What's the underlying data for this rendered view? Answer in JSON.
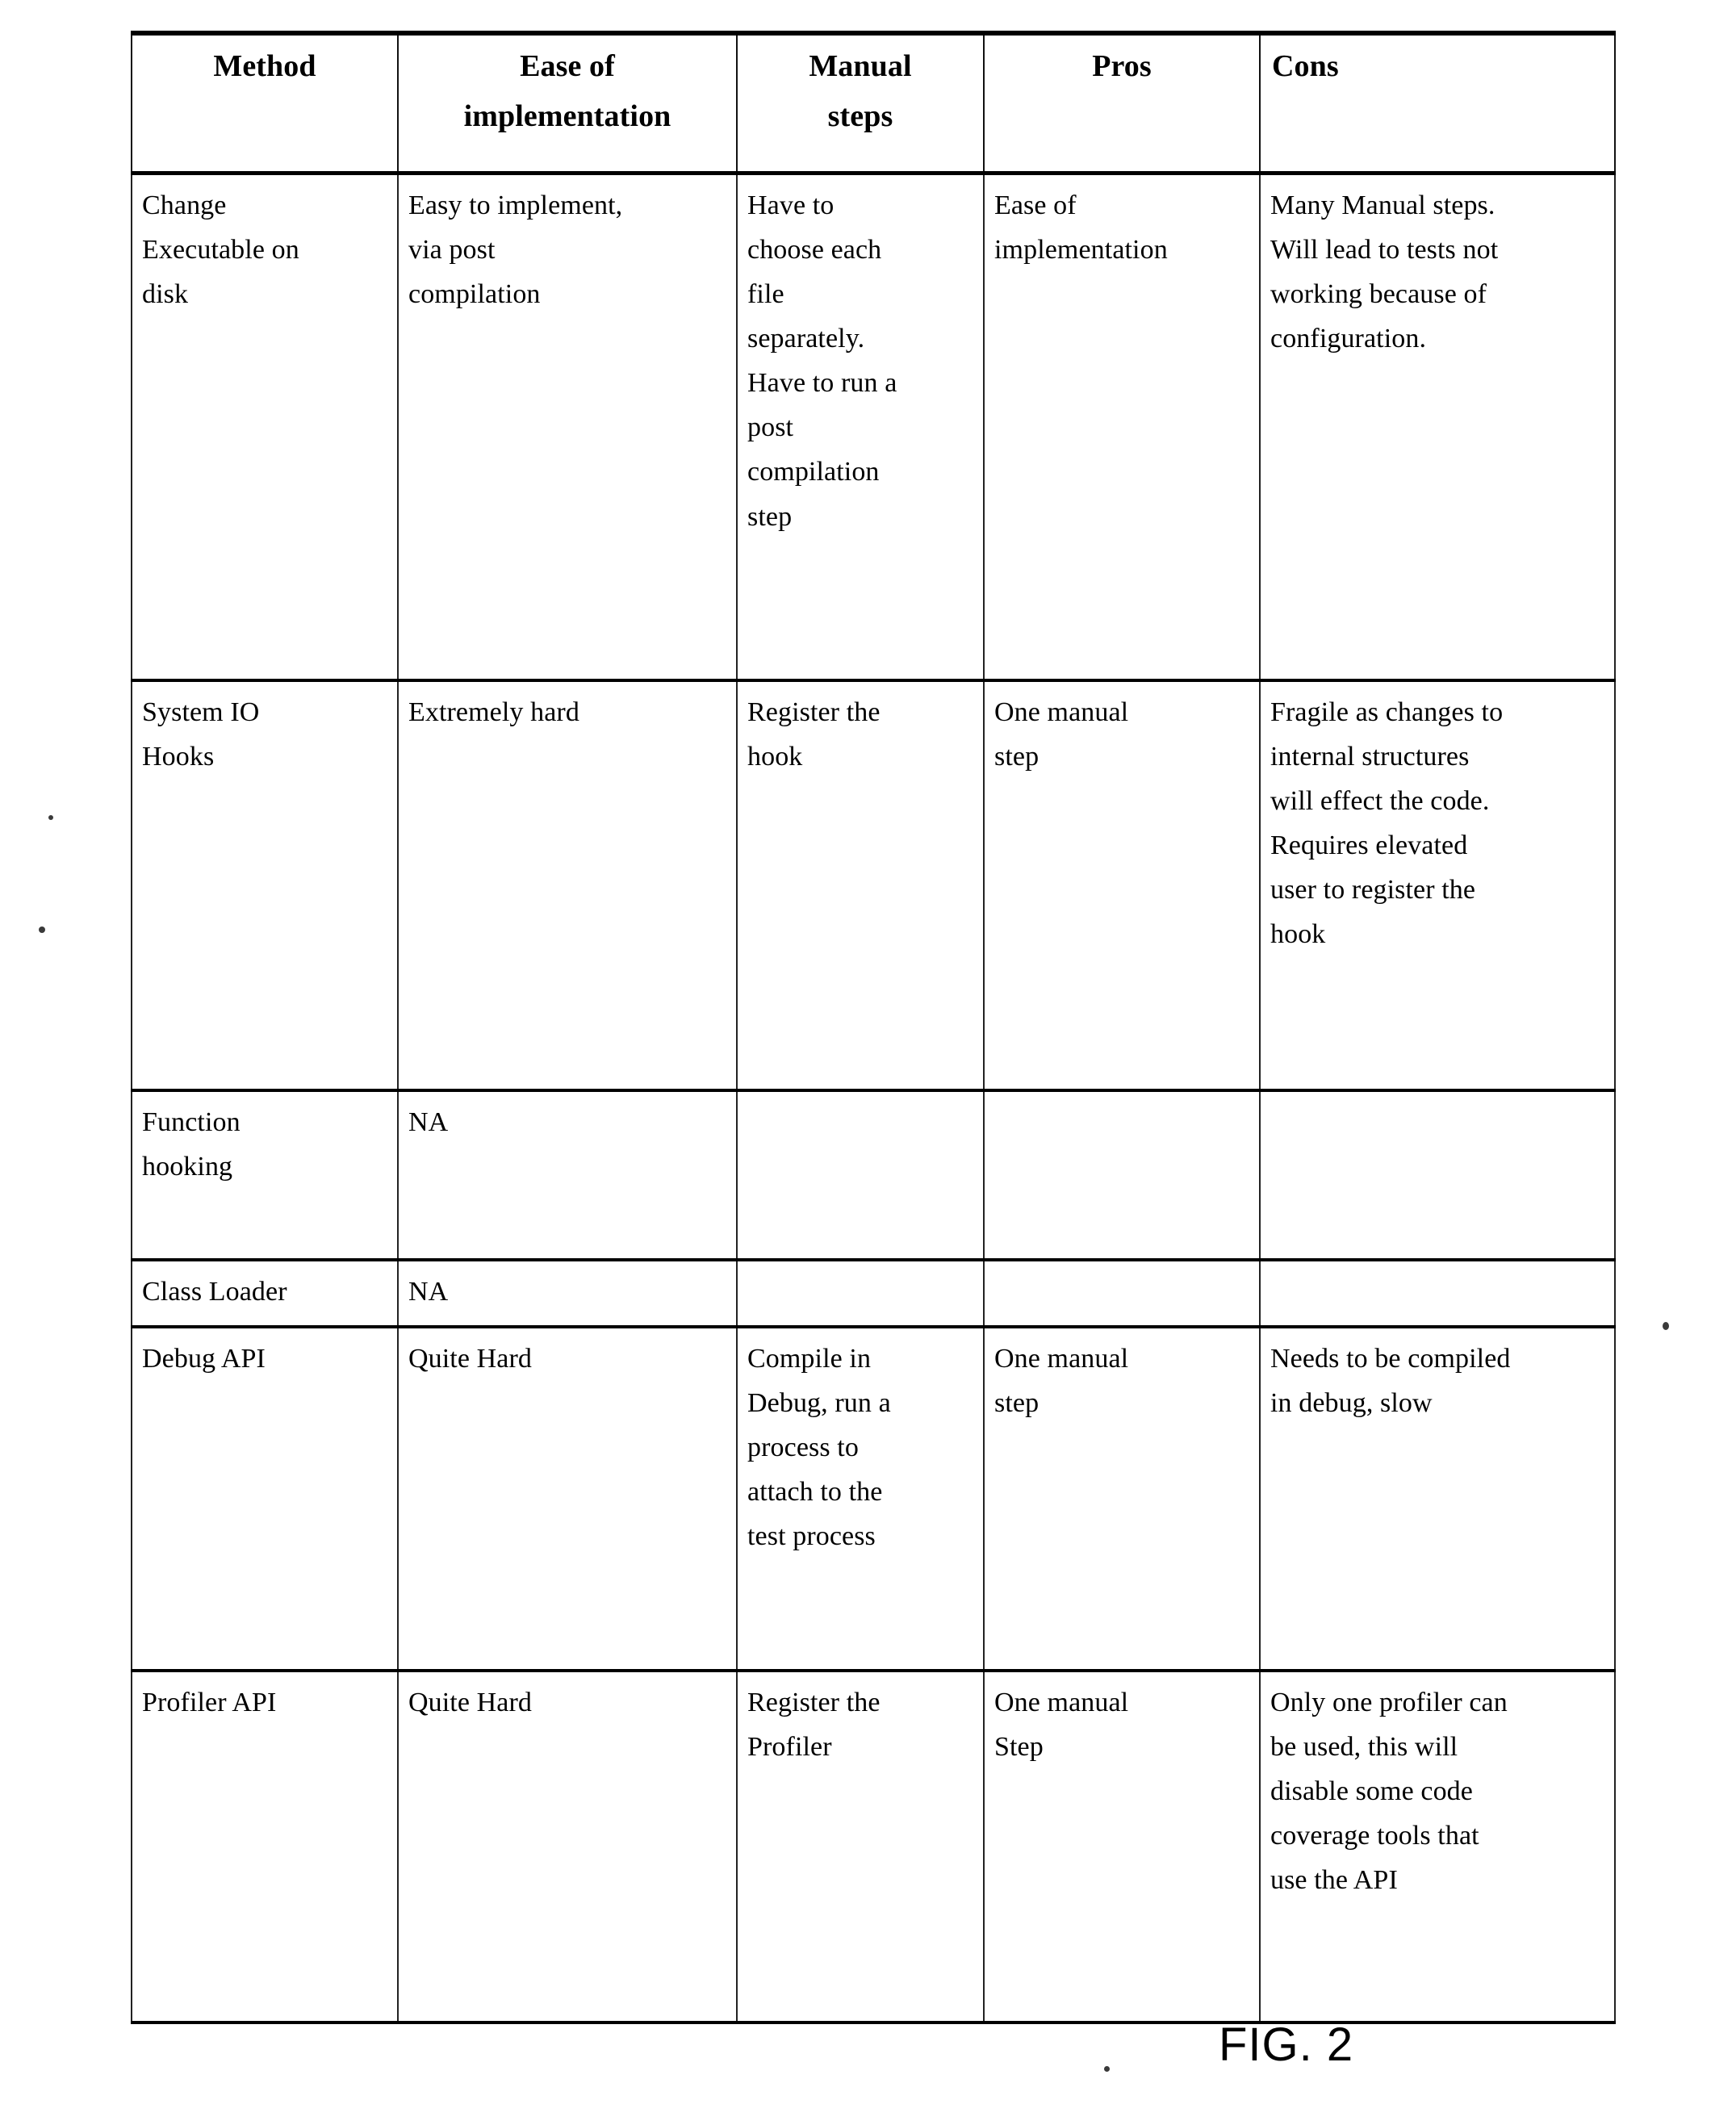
{
  "figure": {
    "caption": "FIG. 2"
  },
  "table": {
    "headers": [
      "Method",
      "Ease of implementation",
      "Manual steps",
      "Pros",
      "Cons"
    ],
    "header_lines": {
      "method": [
        "Method"
      ],
      "ease": [
        "Ease of",
        "implementation"
      ],
      "manual": [
        "Manual",
        "steps"
      ],
      "pros": [
        "Pros"
      ],
      "cons": [
        "Cons"
      ]
    },
    "rows": [
      {
        "method": "Change Executable on disk",
        "method_lines": [
          "Change",
          "Executable on",
          "disk"
        ],
        "ease": "Easy to implement, via post compilation",
        "ease_lines": [
          "Easy to implement,",
          "via post",
          "compilation"
        ],
        "manual": "Have to choose each file separately. Have to run a post compilation step",
        "manual_lines": [
          "Have to",
          "choose each",
          "file",
          "separately.",
          "Have to run a",
          "post",
          "compilation",
          "step"
        ],
        "pros": "Ease of implementation",
        "pros_lines": [
          "Ease of",
          "implementation"
        ],
        "cons": "Many Manual steps. Will lead to tests not working because of configuration.",
        "cons_lines": [
          "Many Manual steps.",
          "Will lead to tests not",
          "working because of",
          "configuration."
        ]
      },
      {
        "method": "System IO Hooks",
        "method_lines": [
          "System IO",
          "Hooks"
        ],
        "ease": "Extremely hard",
        "ease_lines": [
          "Extremely hard"
        ],
        "manual": "Register the hook",
        "manual_lines": [
          "Register the",
          "hook"
        ],
        "pros": "One manual step",
        "pros_lines": [
          "One manual",
          "step"
        ],
        "cons": "Fragile as changes to internal structures will effect the code. Requires elevated user to register the hook",
        "cons_lines": [
          "Fragile as changes to",
          "internal structures",
          "will effect the code.",
          "Requires elevated",
          "user to register the",
          "hook"
        ]
      },
      {
        "method": "Function hooking",
        "method_lines": [
          "Function",
          "hooking"
        ],
        "ease": "NA",
        "ease_lines": [
          "NA"
        ],
        "manual": "",
        "manual_lines": [],
        "pros": "",
        "pros_lines": [],
        "cons": "",
        "cons_lines": []
      },
      {
        "method": "Class Loader",
        "method_lines": [
          "Class Loader"
        ],
        "ease": "NA",
        "ease_lines": [
          "NA"
        ],
        "manual": "",
        "manual_lines": [],
        "pros": "",
        "pros_lines": [],
        "cons": "",
        "cons_lines": []
      },
      {
        "method": "Debug API",
        "method_lines": [
          "Debug API"
        ],
        "ease": "Quite Hard",
        "ease_lines": [
          "Quite Hard"
        ],
        "manual": "Compile in Debug, run a process to attach to the test process",
        "manual_lines": [
          "Compile in",
          "Debug, run a",
          "process to",
          "attach to the",
          "test process"
        ],
        "pros": "One manual step",
        "pros_lines": [
          "One manual",
          "step"
        ],
        "cons": "Needs to be compiled in debug, slow",
        "cons_lines": [
          "Needs to be compiled",
          "in debug, slow"
        ]
      },
      {
        "method": "Profiler API",
        "method_lines": [
          "Profiler API"
        ],
        "ease": "Quite Hard",
        "ease_lines": [
          "Quite Hard"
        ],
        "manual": "Register the Profiler",
        "manual_lines": [
          "Register the",
          "Profiler"
        ],
        "pros": "One manual Step",
        "pros_lines": [
          "One manual",
          "Step"
        ],
        "cons": "Only one profiler can be used, this will disable some code coverage tools that use the API",
        "cons_lines": [
          "Only one profiler can",
          "be used, this will",
          "disable some code",
          "coverage tools that",
          "use the API"
        ]
      }
    ]
  }
}
